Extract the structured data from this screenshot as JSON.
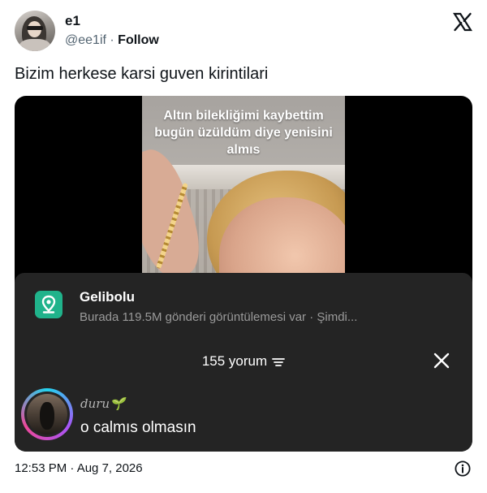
{
  "tweet": {
    "display_name": "e1",
    "handle": "@ee1if",
    "separator": "·",
    "follow_label": "Follow",
    "text": "Bizim herkese karsi guven kirintilari",
    "timestamp": "12:53 PM · Aug 7, 2026"
  },
  "media": {
    "video_caption": "Altın bilekliğimi kaybettim bugün üzüldüm diye yenisini almıs",
    "location": {
      "title": "Gelibolu",
      "subtitle": "Burada 119.5M gönderi görüntülemesi var · Şimdi..."
    },
    "comments": {
      "count_label": "155 yorum",
      "items": [
        {
          "username": "duru🌱",
          "text": "o calmıs olmasın"
        }
      ]
    }
  },
  "icons": {
    "brand": "x-logo-icon",
    "info": "info-icon",
    "close": "close-icon",
    "sort": "sort-icon",
    "location": "location-pin-icon"
  },
  "colors": {
    "location_badge": "#20b38b",
    "sheet_background": "#242424"
  }
}
